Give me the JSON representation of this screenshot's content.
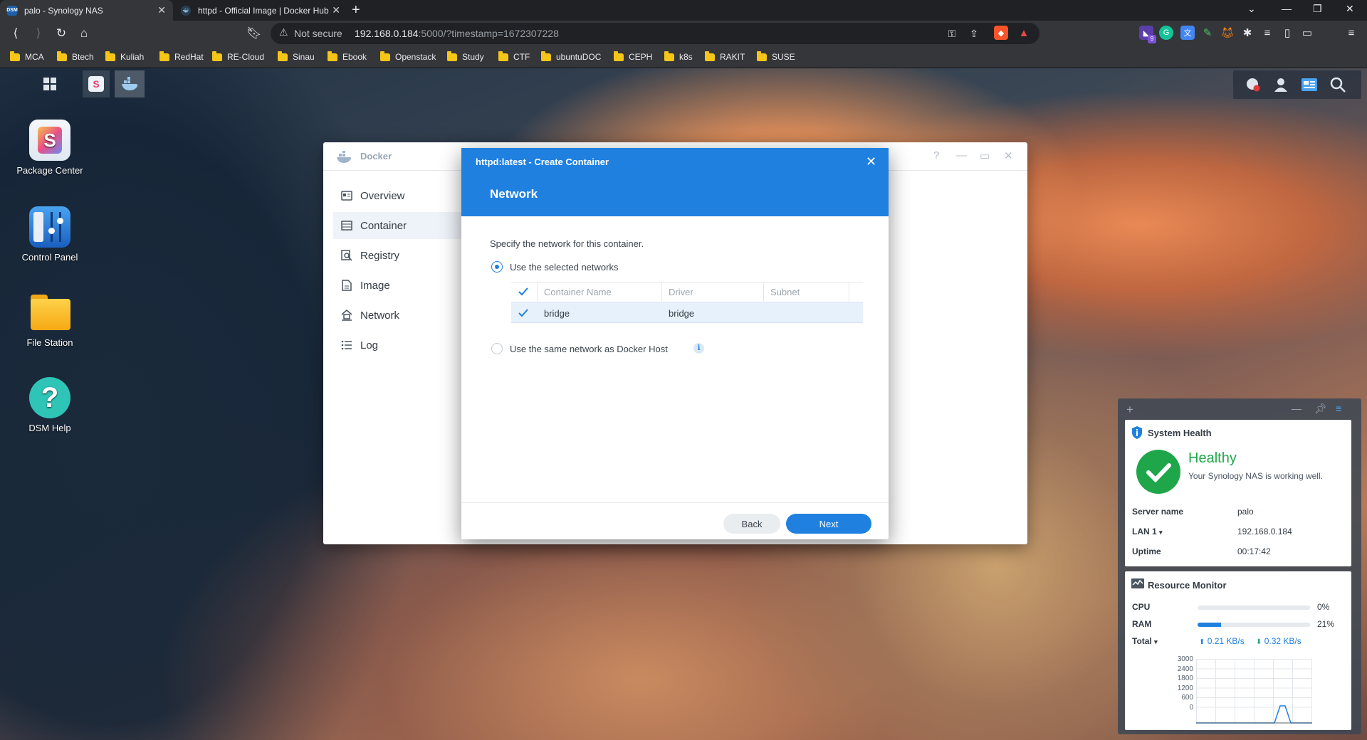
{
  "browser": {
    "tabs": [
      {
        "title": "palo - Synology NAS",
        "favicon": "DSM",
        "active": true
      },
      {
        "title": "httpd - Official Image | Docker Hub",
        "favicon": "docker-icon",
        "active": false
      }
    ],
    "not_secure": "Not secure",
    "url_host": "192.168.0.184",
    "url_rest": ":5000/?timestamp=1672307228",
    "bookmarks": [
      "MCA",
      "Btech",
      "Kuliah",
      "RedHat",
      "RE-Cloud",
      "Sinau",
      "Ebook",
      "Openstack",
      "Study",
      "CTF",
      "ubuntuDOC",
      "CEPH",
      "k8s",
      "RAKIT",
      "SUSE"
    ],
    "ext_badge": "9"
  },
  "desktop": {
    "icons": [
      {
        "label": "Package Center"
      },
      {
        "label": "Control Panel"
      },
      {
        "label": "File Station"
      },
      {
        "label": "DSM Help"
      }
    ]
  },
  "docker": {
    "title": "Docker",
    "sidebar": [
      {
        "label": "Overview",
        "icon": "overview-icon"
      },
      {
        "label": "Container",
        "icon": "container-icon",
        "selected": true
      },
      {
        "label": "Registry",
        "icon": "registry-icon"
      },
      {
        "label": "Image",
        "icon": "image-icon"
      },
      {
        "label": "Network",
        "icon": "network-icon"
      },
      {
        "label": "Log",
        "icon": "log-icon"
      }
    ]
  },
  "dialog": {
    "subtitle": "httpd:latest - Create Container",
    "title": "Network",
    "description": "Specify the network for this container.",
    "option_selected": "Use the selected networks",
    "option_host": "Use the same network as Docker Host",
    "table": {
      "headers": [
        "Container Name",
        "Driver",
        "Subnet"
      ],
      "rows": [
        {
          "name": "bridge",
          "driver": "bridge",
          "subnet": "",
          "checked": true
        }
      ]
    },
    "back": "Back",
    "next": "Next"
  },
  "widgets": {
    "system_health": {
      "title": "System Health",
      "status": "Healthy",
      "message": "Your Synology NAS is working well.",
      "server_name_label": "Server name",
      "server_name": "palo",
      "lan_label": "LAN 1",
      "lan": "192.168.0.184",
      "uptime_label": "Uptime",
      "uptime": "00:17:42"
    },
    "resource_monitor": {
      "title": "Resource Monitor",
      "cpu_label": "CPU",
      "cpu": "0%",
      "cpu_value": 0,
      "ram_label": "RAM",
      "ram": "21%",
      "ram_value": 21,
      "total_label": "Total",
      "upload": "0.21 KB/s",
      "download": "0.32 KB/s",
      "y_ticks": [
        "3000",
        "2400",
        "1800",
        "1200",
        "600",
        "0"
      ],
      "accent": "#1f80df"
    }
  }
}
